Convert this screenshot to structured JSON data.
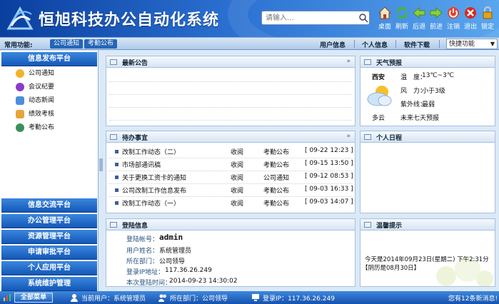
{
  "header": {
    "title": "恒旭科技办公自动化系统",
    "search_placeholder": "请输入..."
  },
  "toolbar": [
    {
      "label": "桌面",
      "icon": "home-icon"
    },
    {
      "label": "刷新",
      "icon": "refresh-icon"
    },
    {
      "label": "后退",
      "icon": "back-arrow-icon"
    },
    {
      "label": "前进",
      "icon": "forward-arrow-icon"
    },
    {
      "label": "注销",
      "icon": "power-icon"
    },
    {
      "label": "退出",
      "icon": "close-icon"
    },
    {
      "label": "锁定",
      "icon": "lock-icon"
    }
  ],
  "navbar": {
    "common_label": "常用功能:",
    "chip1": "公司通知",
    "chip2": "考勤公布",
    "link1": "用户信息",
    "link2": "个人信息",
    "link3": "软件下载",
    "quick_select": "快捷功能"
  },
  "sidebar": {
    "top_header": "信息发布平台",
    "items": [
      "公司通知",
      "会议纪要",
      "动态新闻",
      "绩效考核",
      "考勤公布"
    ],
    "bottom_headers": [
      "信息交流平台",
      "办公管理平台",
      "资源管理平台",
      "申请审批平台",
      "个人应用平台",
      "系统维护管理"
    ]
  },
  "announce": {
    "title": "最新公告",
    "more": "»"
  },
  "weather": {
    "title": "天气预报",
    "city": "西安",
    "temp_label": "温　度：",
    "temp_value": "13℃~3℃",
    "wind_label": "风　力：",
    "wind_value": "小于3级",
    "uv_label": "紫外线：",
    "uv_value": "最弱",
    "condition": "多云",
    "forecast_link": "未来七天预报"
  },
  "todo": {
    "title": "待办事宜",
    "more": "»",
    "rows": [
      {
        "title": "改制工作动态（二）",
        "status": "收阅",
        "category": "考勤公布",
        "time": "[ 09-22 12:23 ]"
      },
      {
        "title": "市场部通讯稿",
        "status": "收阅",
        "category": "考勤公布",
        "time": "[ 09-15 13:50 ]"
      },
      {
        "title": "关于更换工资卡的通知",
        "status": "收阅",
        "category": "公司通知",
        "time": "[ 09-12 08:53 ]"
      },
      {
        "title": "公司改制工作信息发布",
        "status": "收阅",
        "category": "考勤公布",
        "time": "[ 09-03 16:33 ]"
      },
      {
        "title": "改制工作动态（一）",
        "status": "收阅",
        "category": "考勤公布",
        "time": "[ 09-03 14:07 ]"
      }
    ]
  },
  "schedule": {
    "title": "个人日程"
  },
  "login": {
    "title": "登陆信息",
    "account_label": "登陆帐号：",
    "account_value": "admin",
    "name_label": "用户姓名：",
    "name_value": "系统管理员",
    "dept_label": "所在部门：",
    "dept_value": "公司领导",
    "ip_label": "登录IP地址：",
    "ip_value": "117.36.26.249",
    "last_label": "本次登陆时间：",
    "last_value": "2014-09-23 14:30:02"
  },
  "tips": {
    "title": "温馨提示",
    "line1": "今天是2014年09月23日(星期二) 下午2:31分",
    "line2": "【阴历是08月30日】"
  },
  "status": {
    "start": "全部菜单",
    "user": "当前用户：系统管理员",
    "dept": "所在部门：公司领导",
    "ip": "登录IP：117.36.26.249",
    "messages": "您有12条新消息!"
  },
  "colors": {
    "header_dark": "#0a3f9e",
    "accent": "#1458b8",
    "panel_border": "#a9bfdc"
  }
}
